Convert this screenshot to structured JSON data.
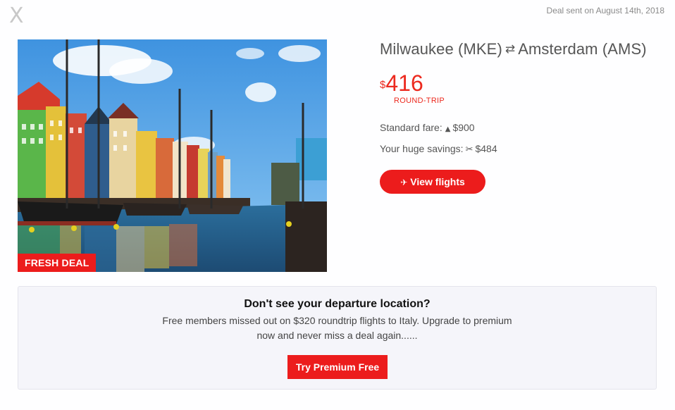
{
  "header": {
    "close_label": "X",
    "sent_date": "Deal sent on August 14th, 2018"
  },
  "deal": {
    "badge": "FRESH DEAL",
    "origin": "Milwaukee (MKE)",
    "destination": "Amsterdam (AMS)",
    "route_icon": "roundtrip-arrows-icon",
    "currency_symbol": "$",
    "price": "416",
    "trip_type": "ROUND-TRIP",
    "standard_fare_label": "Standard fare:",
    "standard_fare_icon": "up-triangle-icon",
    "standard_fare_value": "$900",
    "savings_label": "Your huge savings:",
    "savings_icon": "scissors-icon",
    "savings_value": "$484",
    "view_button_icon": "plane-icon",
    "view_button_label": "View flights",
    "accent_color": "#ec1c1c"
  },
  "promo": {
    "title": "Don't see your departure location?",
    "text": "Free members missed out on $320 roundtrip flights to Italy. Upgrade to premium now and never miss a deal again......",
    "button_label": "Try Premium Free"
  }
}
